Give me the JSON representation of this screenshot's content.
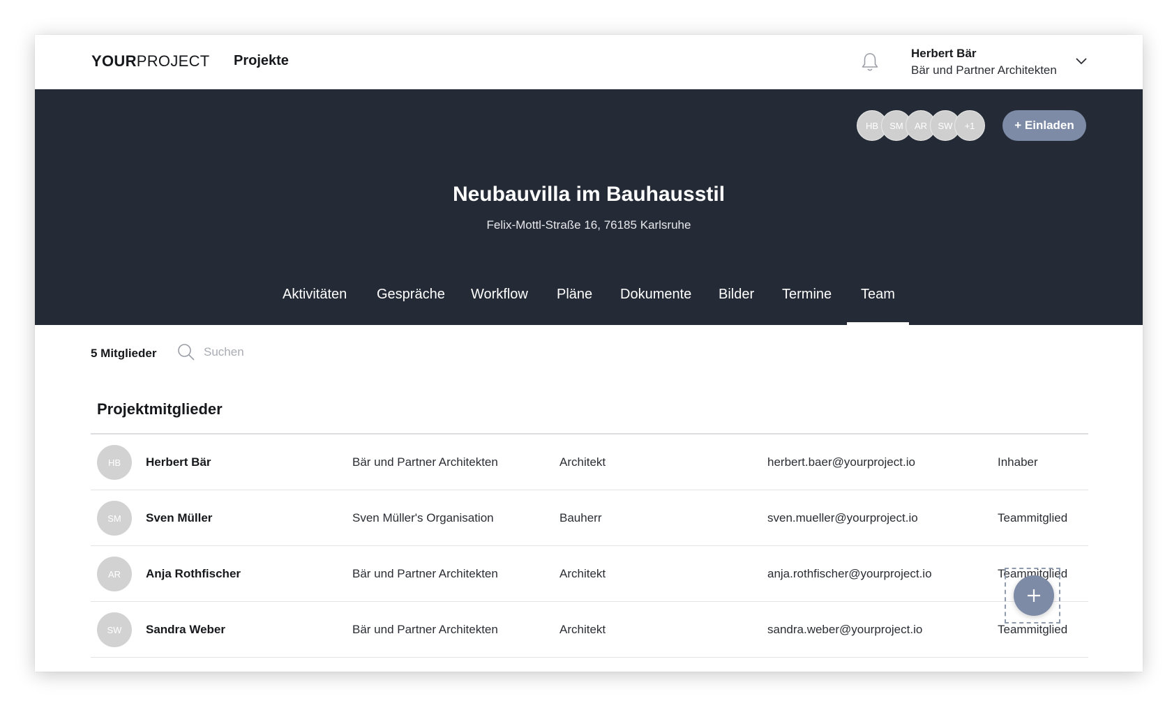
{
  "topbar": {
    "logo_bold": "YOUR",
    "logo_light": "PROJECT",
    "nav_projects": "Projekte",
    "user_name": "Herbert Bär",
    "user_org": "Bär und Partner Architekten"
  },
  "header": {
    "avatars": [
      "HB",
      "SM",
      "AR",
      "SW",
      "+1"
    ],
    "invite_label": "+ Einladen",
    "project_title": "Neubauvilla im Bauhausstil",
    "project_address": "Felix-Mottl-Straße 16, 76185 Karlsruhe",
    "tabs": [
      {
        "label": "Aktivitäten"
      },
      {
        "label": "Gespräche"
      },
      {
        "label": "Workflow"
      },
      {
        "label": "Pläne"
      },
      {
        "label": "Dokumente"
      },
      {
        "label": "Bilder"
      },
      {
        "label": "Termine"
      },
      {
        "label": "Team",
        "active": true
      }
    ]
  },
  "toolbar": {
    "members_count": "5 Mitglieder",
    "search_placeholder": "Suchen"
  },
  "members": {
    "section_title": "Projektmitglieder",
    "rows": [
      {
        "initials": "HB",
        "name": "Herbert Bär",
        "org": "Bär und Partner Architekten",
        "role": "Architekt",
        "email": "herbert.baer@yourproject.io",
        "permission": "Inhaber"
      },
      {
        "initials": "SM",
        "name": "Sven Müller",
        "org": "Sven Müller's Organisation",
        "role": "Bauherr",
        "email": "sven.mueller@yourproject.io",
        "permission": "Teammitglied"
      },
      {
        "initials": "AR",
        "name": "Anja Rothfischer",
        "org": "Bär und Partner Architekten",
        "role": "Architekt",
        "email": "anja.rothfischer@yourproject.io",
        "permission": "Teammitglied"
      },
      {
        "initials": "SW",
        "name": "Sandra Weber",
        "org": "Bär und Partner Architekten",
        "role": "Architekt",
        "email": "sandra.weber@yourproject.io",
        "permission": "Teammitglied"
      }
    ]
  },
  "icons": {
    "bell": "bell-icon",
    "chevron": "chevron-down-icon",
    "search": "search-icon",
    "fab": "plus-icon"
  },
  "colors": {
    "header_bg": "#252b36",
    "accent": "#7d8ba7",
    "avatar_bg": "#d2d2d2"
  }
}
